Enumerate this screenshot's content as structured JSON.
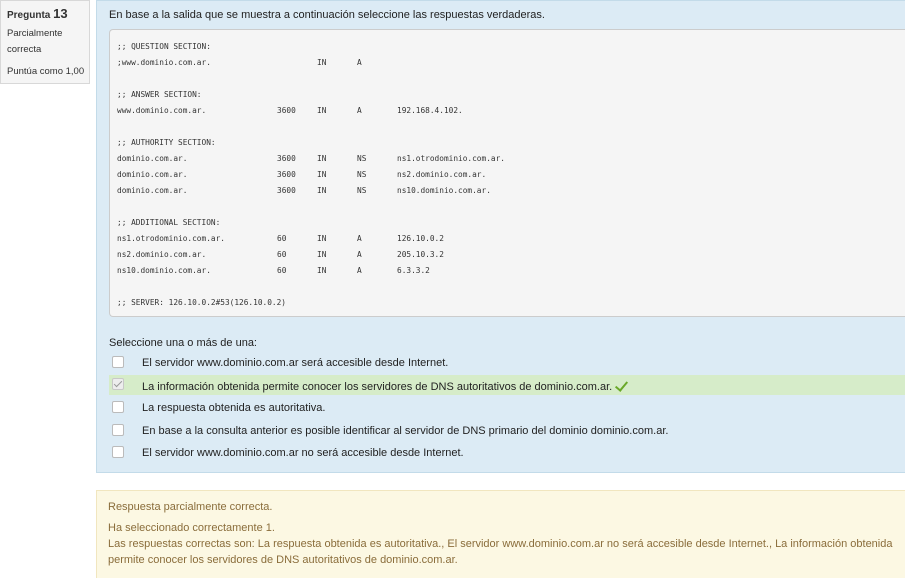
{
  "info": {
    "question_label": "Pregunta",
    "question_number": "13",
    "state": "Parcialmente correcta",
    "grade": "Puntúa como 1,00"
  },
  "question": {
    "text": "En base a la salida que se muestra a continuación seleccione las respuestas verdaderas.",
    "output": {
      "question_header": ";; QUESTION SECTION:",
      "question_row": [
        ";www.dominio.com.ar.",
        "",
        "IN",
        "A",
        ""
      ],
      "answer_header": ";; ANSWER SECTION:",
      "answer_row": [
        "www.dominio.com.ar.",
        "3600",
        "IN",
        "A",
        "192.168.4.102."
      ],
      "authority_header": ";; AUTHORITY SECTION:",
      "authority_rows": [
        [
          "dominio.com.ar.",
          "3600",
          "IN",
          "NS",
          "ns1.otrodominio.com.ar."
        ],
        [
          "dominio.com.ar.",
          "3600",
          "IN",
          "NS",
          "ns2.dominio.com.ar."
        ],
        [
          "dominio.com.ar.",
          "3600",
          "IN",
          "NS",
          "ns10.dominio.com.ar."
        ]
      ],
      "additional_header": ";; ADDITIONAL SECTION:",
      "additional_rows": [
        [
          "ns1.otrodominio.com.ar.",
          "60",
          "IN",
          "A",
          "126.10.0.2"
        ],
        [
          "ns2.dominio.com.ar.",
          "60",
          "IN",
          "A",
          "205.10.3.2"
        ],
        [
          "ns10.dominio.com.ar.",
          "60",
          "IN",
          "A",
          "6.3.3.2"
        ]
      ],
      "server_line": ";; SERVER: 126.10.0.2#53(126.10.0.2)"
    },
    "prompt": "Seleccione una o más de una:",
    "options": [
      {
        "label": "El servidor www.dominio.com.ar será accesible desde Internet.",
        "checked": false,
        "marked_correct": false
      },
      {
        "label": "La información obtenida permite conocer los servidores de DNS autoritativos de dominio.com.ar.",
        "checked": true,
        "marked_correct": true
      },
      {
        "label": "La respuesta obtenida es autoritativa.",
        "checked": false,
        "marked_correct": false
      },
      {
        "label": "En base a la consulta anterior es posible identificar al servidor de DNS primario del dominio dominio.com.ar.",
        "checked": false,
        "marked_correct": false
      },
      {
        "label": "El servidor www.dominio.com.ar no será accesible desde Internet.",
        "checked": false,
        "marked_correct": false
      }
    ]
  },
  "feedback": {
    "status": "Respuesta parcialmente correcta.",
    "selected": "Ha seleccionado correctamente 1.",
    "correct_answers": "Las respuestas correctas son: La respuesta obtenida es autoritativa., El servidor www.dominio.com.ar no será accesible desde Internet., La información obtenida permite conocer los servidores de DNS autoritativos de dominio.com.ar."
  },
  "colors": {
    "formulation_bg": "#dcebf5",
    "correct_option_bg": "#d6ecc9",
    "feedback_bg": "#fcf8e3",
    "feedback_text": "#8a6d3b",
    "tick": "#6aa829"
  },
  "icons": {
    "correct_mark": "check-icon"
  }
}
